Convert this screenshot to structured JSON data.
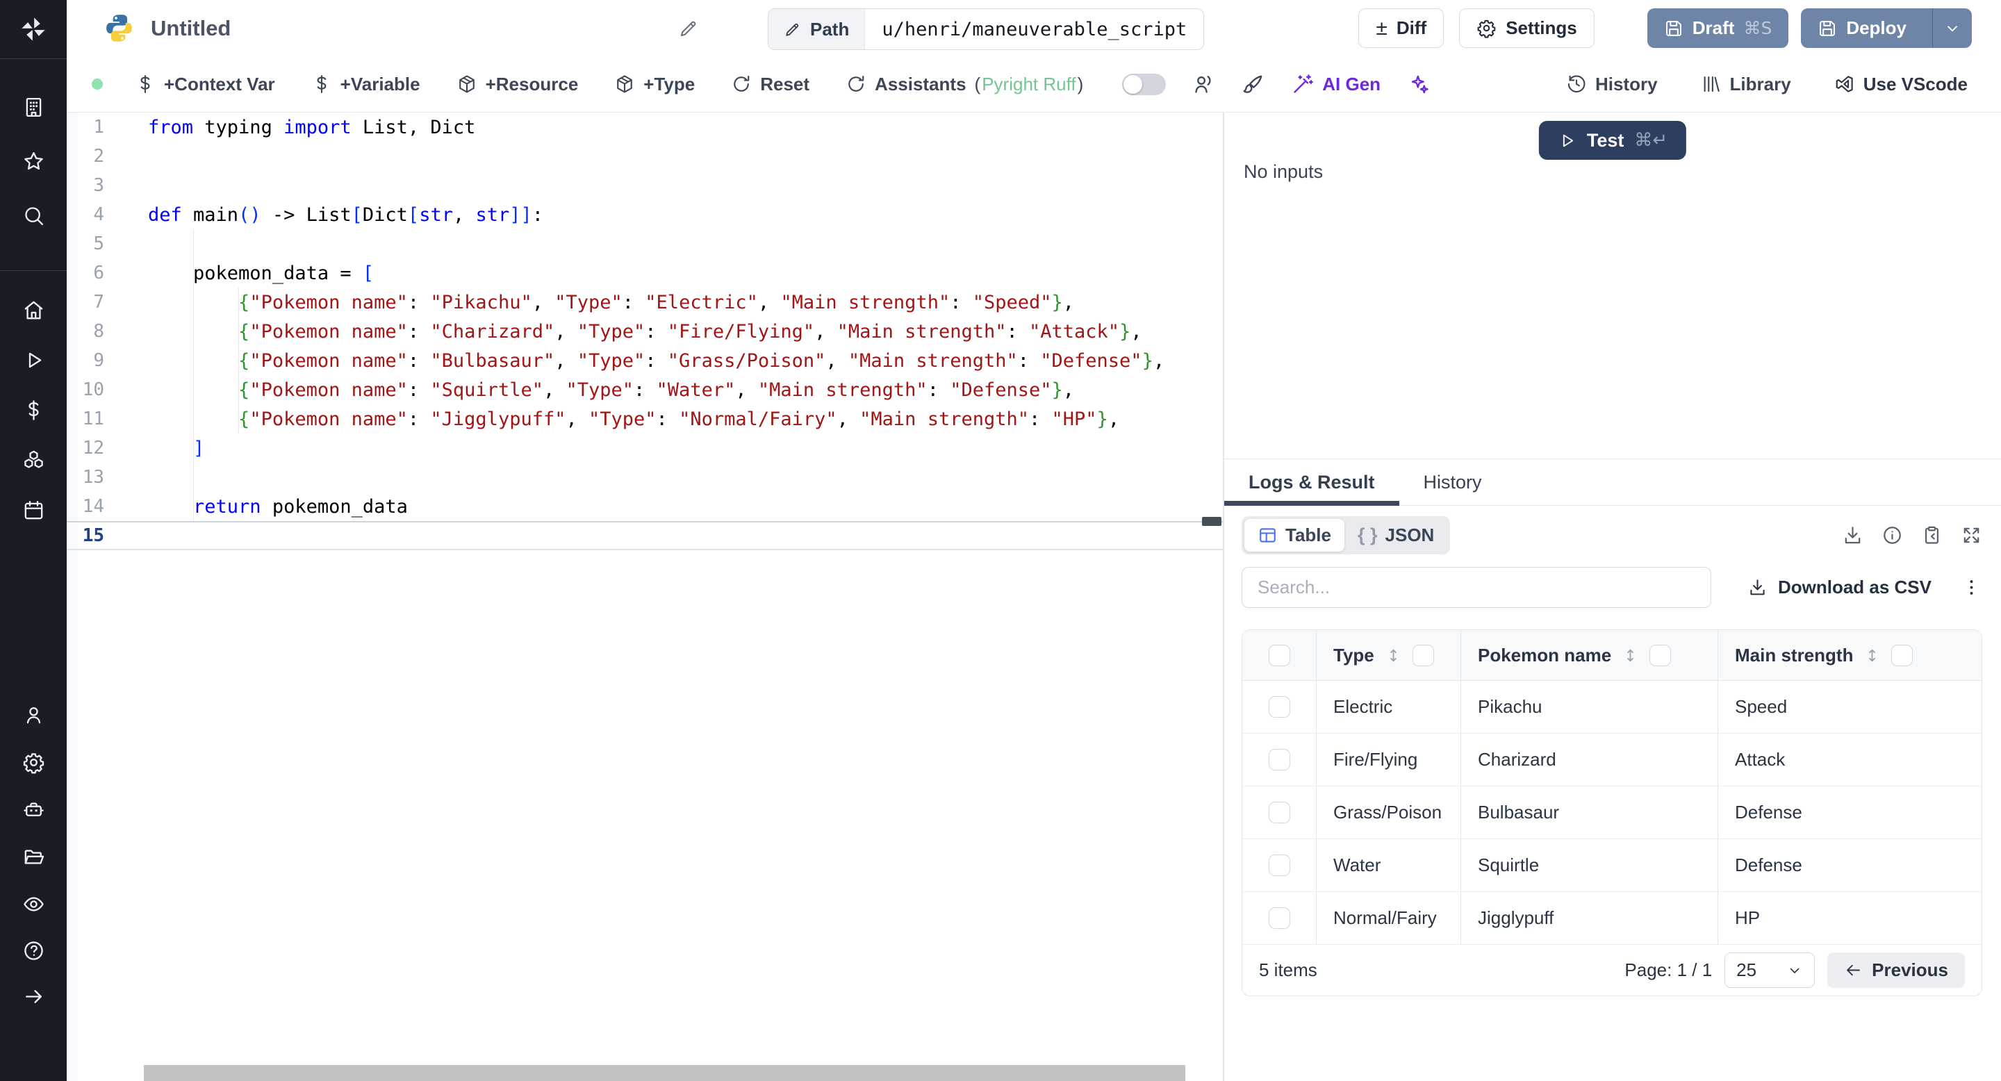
{
  "app": {
    "slate_button_color": "#6e85a8",
    "navy_button_color": "#2d3e5f",
    "purple_accent": "#6d28d9",
    "language_dot_color": "#8de3ac",
    "assistant_green": "#74c591",
    "table_icon_blue": "#4a6cf7"
  },
  "topbar": {
    "title": "Untitled",
    "path_label": "Path",
    "path_value": "u/henri/maneuverable_script",
    "diff_label": "Diff",
    "diff_glyph": "±",
    "settings_label": "Settings",
    "draft_label": "Draft",
    "draft_shortcut": "⌘S",
    "deploy_label": "Deploy"
  },
  "toolbar": {
    "left": [
      {
        "icon": "dollar",
        "label": "+Context Var"
      },
      {
        "icon": "dollar",
        "label": "+Variable"
      },
      {
        "icon": "package",
        "label": "+Resource"
      },
      {
        "icon": "package",
        "label": "+Type"
      },
      {
        "icon": "refresh",
        "label": "Reset"
      },
      {
        "icon": "refresh",
        "label": "Assistants",
        "paren_open": "(",
        "paren_text": "Pyright Ruff",
        "paren_close": ")"
      }
    ],
    "ai_gen_label": "AI Gen",
    "right": [
      {
        "icon": "history",
        "label": "History"
      },
      {
        "icon": "library",
        "label": "Library"
      },
      {
        "icon": "vscode",
        "label": "Use VScode"
      }
    ]
  },
  "sidebar": {
    "top": [
      "building",
      "star",
      "search"
    ],
    "middle": [
      "home",
      "play",
      "dollar",
      "boxes",
      "calendar"
    ],
    "lower": [
      "user",
      "gear",
      "robot",
      "folder",
      "eye"
    ],
    "bottom": [
      "help",
      "arrow-right"
    ]
  },
  "editor": {
    "lines": [
      {
        "n": 1,
        "t": [
          [
            "k",
            "from"
          ],
          [
            "p",
            " typing "
          ],
          [
            "k",
            "import"
          ],
          [
            "p",
            " List, Dict"
          ]
        ]
      },
      {
        "n": 2,
        "t": []
      },
      {
        "n": 3,
        "t": []
      },
      {
        "n": 4,
        "t": [
          [
            "k",
            "def"
          ],
          [
            "p",
            " main"
          ],
          [
            "bb",
            "()"
          ],
          [
            "p",
            " -> List"
          ],
          [
            "bb",
            "["
          ],
          [
            "p",
            "Dict"
          ],
          [
            "bb",
            "["
          ],
          [
            "k",
            "str"
          ],
          [
            "p",
            ", "
          ],
          [
            "k",
            "str"
          ],
          [
            "bb",
            "]]"
          ],
          [
            "p",
            ":"
          ]
        ]
      },
      {
        "n": 5,
        "t": []
      },
      {
        "n": 6,
        "t": [
          [
            "p",
            "    pokemon_data = "
          ],
          [
            "bb",
            "["
          ]
        ]
      },
      {
        "n": 7,
        "t": [
          [
            "p",
            "        "
          ],
          [
            "bg",
            "{"
          ],
          [
            "s",
            "\"Pokemon name\""
          ],
          [
            "p",
            ": "
          ],
          [
            "s",
            "\"Pikachu\""
          ],
          [
            "p",
            ", "
          ],
          [
            "s",
            "\"Type\""
          ],
          [
            "p",
            ": "
          ],
          [
            "s",
            "\"Electric\""
          ],
          [
            "p",
            ", "
          ],
          [
            "s",
            "\"Main strength\""
          ],
          [
            "p",
            ": "
          ],
          [
            "s",
            "\"Speed\""
          ],
          [
            "bg",
            "}"
          ],
          [
            "p",
            ","
          ]
        ]
      },
      {
        "n": 8,
        "t": [
          [
            "p",
            "        "
          ],
          [
            "bg",
            "{"
          ],
          [
            "s",
            "\"Pokemon name\""
          ],
          [
            "p",
            ": "
          ],
          [
            "s",
            "\"Charizard\""
          ],
          [
            "p",
            ", "
          ],
          [
            "s",
            "\"Type\""
          ],
          [
            "p",
            ": "
          ],
          [
            "s",
            "\"Fire/Flying\""
          ],
          [
            "p",
            ", "
          ],
          [
            "s",
            "\"Main strength\""
          ],
          [
            "p",
            ": "
          ],
          [
            "s",
            "\"Attack\""
          ],
          [
            "bg",
            "}"
          ],
          [
            "p",
            ","
          ]
        ]
      },
      {
        "n": 9,
        "t": [
          [
            "p",
            "        "
          ],
          [
            "bg",
            "{"
          ],
          [
            "s",
            "\"Pokemon name\""
          ],
          [
            "p",
            ": "
          ],
          [
            "s",
            "\"Bulbasaur\""
          ],
          [
            "p",
            ", "
          ],
          [
            "s",
            "\"Type\""
          ],
          [
            "p",
            ": "
          ],
          [
            "s",
            "\"Grass/Poison\""
          ],
          [
            "p",
            ", "
          ],
          [
            "s",
            "\"Main strength\""
          ],
          [
            "p",
            ": "
          ],
          [
            "s",
            "\"Defense\""
          ],
          [
            "bg",
            "}"
          ],
          [
            "p",
            ","
          ]
        ]
      },
      {
        "n": 10,
        "t": [
          [
            "p",
            "        "
          ],
          [
            "bg",
            "{"
          ],
          [
            "s",
            "\"Pokemon name\""
          ],
          [
            "p",
            ": "
          ],
          [
            "s",
            "\"Squirtle\""
          ],
          [
            "p",
            ", "
          ],
          [
            "s",
            "\"Type\""
          ],
          [
            "p",
            ": "
          ],
          [
            "s",
            "\"Water\""
          ],
          [
            "p",
            ", "
          ],
          [
            "s",
            "\"Main strength\""
          ],
          [
            "p",
            ": "
          ],
          [
            "s",
            "\"Defense\""
          ],
          [
            "bg",
            "}"
          ],
          [
            "p",
            ","
          ]
        ]
      },
      {
        "n": 11,
        "t": [
          [
            "p",
            "        "
          ],
          [
            "bg",
            "{"
          ],
          [
            "s",
            "\"Pokemon name\""
          ],
          [
            "p",
            ": "
          ],
          [
            "s",
            "\"Jigglypuff\""
          ],
          [
            "p",
            ", "
          ],
          [
            "s",
            "\"Type\""
          ],
          [
            "p",
            ": "
          ],
          [
            "s",
            "\"Normal/Fairy\""
          ],
          [
            "p",
            ", "
          ],
          [
            "s",
            "\"Main strength\""
          ],
          [
            "p",
            ": "
          ],
          [
            "s",
            "\"HP\""
          ],
          [
            "bg",
            "}"
          ],
          [
            "p",
            ","
          ]
        ]
      },
      {
        "n": 12,
        "t": [
          [
            "p",
            "    "
          ],
          [
            "bb",
            "]"
          ]
        ]
      },
      {
        "n": 13,
        "t": []
      },
      {
        "n": 14,
        "t": [
          [
            "p",
            "    "
          ],
          [
            "k",
            "return"
          ],
          [
            "p",
            " pokemon_data"
          ]
        ]
      },
      {
        "n": 15,
        "t": [],
        "current": true
      }
    ]
  },
  "run": {
    "test_label": "Test",
    "test_shortcut": "⌘↵",
    "no_inputs": "No inputs"
  },
  "result": {
    "tabs": [
      {
        "label": "Logs & Result",
        "active": true
      },
      {
        "label": "History",
        "active": false
      }
    ],
    "views": [
      {
        "icon": "table",
        "label": "Table",
        "active": true
      },
      {
        "icon": "braces",
        "label": "JSON",
        "active": false
      }
    ],
    "search_placeholder": "Search...",
    "download_csv_label": "Download as CSV",
    "table": {
      "columns": [
        "Type",
        "Pokemon name",
        "Main strength"
      ],
      "rows": [
        [
          "Electric",
          "Pikachu",
          "Speed"
        ],
        [
          "Fire/Flying",
          "Charizard",
          "Attack"
        ],
        [
          "Grass/Poison",
          "Bulbasaur",
          "Defense"
        ],
        [
          "Water",
          "Squirtle",
          "Defense"
        ],
        [
          "Normal/Fairy",
          "Jigglypuff",
          "HP"
        ]
      ]
    },
    "footer": {
      "count_text": "5 items",
      "page_text": "Page: 1 / 1",
      "page_size": "25",
      "previous_label": "Previous"
    }
  }
}
